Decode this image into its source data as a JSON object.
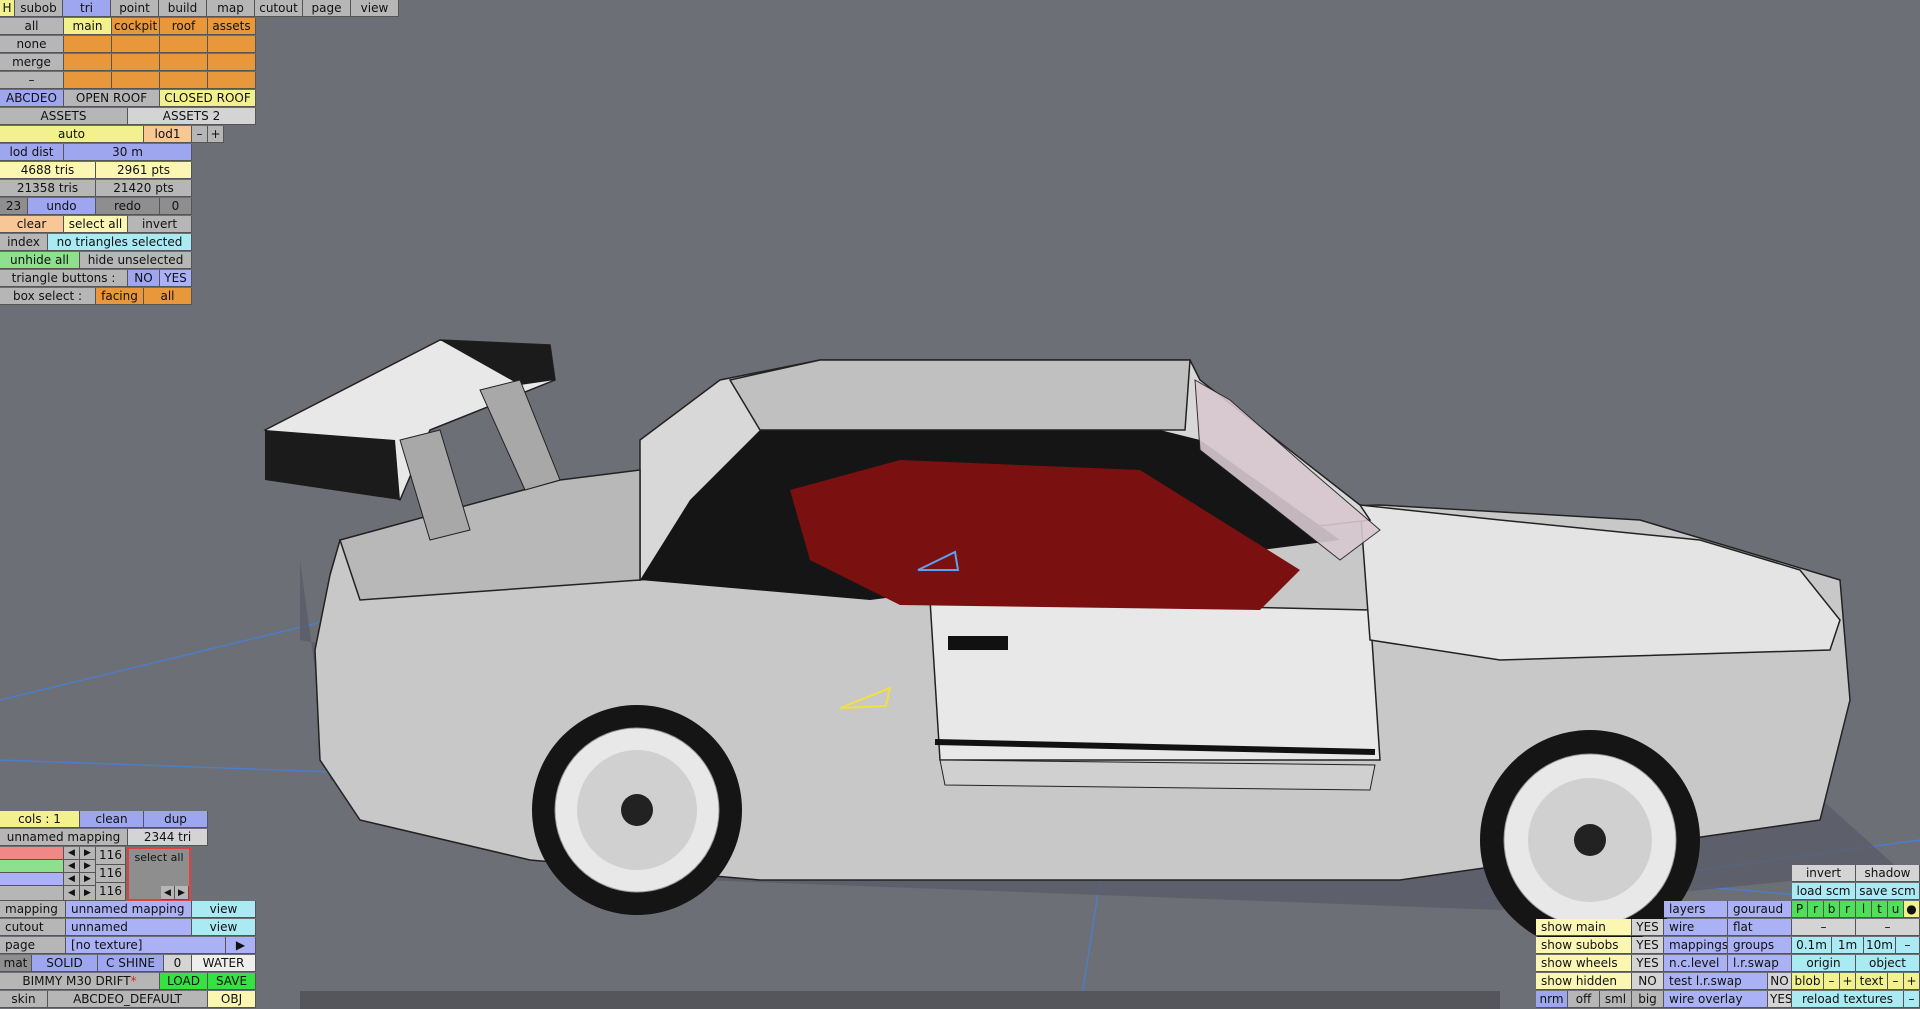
{
  "menu": {
    "h": "H",
    "items": [
      "subob",
      "tri",
      "point",
      "build",
      "map",
      "cutout",
      "page",
      "view"
    ]
  },
  "subob": {
    "all": "all",
    "none": "none",
    "merge": "merge",
    "minus": "–",
    "names": [
      "main",
      "cockpit",
      "roof",
      "assets"
    ]
  },
  "configs": [
    "ABCDEO",
    "OPEN ROOF",
    "CLOSED ROOF"
  ],
  "assets": [
    "ASSETS",
    "ASSETS 2"
  ],
  "lod": {
    "mode": "auto",
    "level": "lod1",
    "minus": "–",
    "plus": "+",
    "dist_label": "lod dist",
    "dist_value": "30 m"
  },
  "stats": {
    "lod_tris": "4688 tris",
    "lod_pts": "2961 pts",
    "total_tris": "21358 tris",
    "total_pts": "21420 pts"
  },
  "history": {
    "undo_count": "23",
    "undo": "undo",
    "redo": "redo",
    "redo_count": "0"
  },
  "selection": {
    "clear": "clear",
    "select_all": "select all",
    "invert": "invert",
    "index_label": "index",
    "status": "no triangles selected"
  },
  "visibility": {
    "unhide_all": "unhide all",
    "hide_unselected": "hide unselected"
  },
  "triangle_buttons": {
    "label": "triangle buttons :",
    "no": "NO",
    "yes": "YES"
  },
  "box_select": {
    "label": "box select :",
    "facing": "facing",
    "all": "all"
  },
  "cols": {
    "label": "cols : 1",
    "clean": "clean",
    "dup": "dup"
  },
  "mapping_panel": {
    "name": "unnamed mapping",
    "tris": "2344 tri"
  },
  "colors": [
    "116",
    "116",
    "116"
  ],
  "arrows": {
    "left": "◀",
    "right": "▶"
  },
  "colour_preview": {
    "label": "select all"
  },
  "bottom_panel": {
    "mapping_label": "mapping",
    "mapping_value": "unnamed mapping",
    "view": "view",
    "cutout_label": "cutout",
    "cutout_value": "unnamed",
    "page_label": "page",
    "page_value": "[no texture]",
    "page_arrow": "▶"
  },
  "material": {
    "label": "mat",
    "solid": "SOLID",
    "c_shine": "C SHINE",
    "value": "0",
    "water": "WATER"
  },
  "model": {
    "name": "BIMMY M30 DRIFT",
    "modified": "*",
    "load": "LOAD",
    "save": "SAVE"
  },
  "skin": {
    "label": "skin",
    "value": "ABCDEO_DEFAULT",
    "obj": "OBJ"
  },
  "view_panel": {
    "invert": "invert",
    "shadow": "shadow",
    "load_scm": "load scm",
    "save_scm": "save scm"
  },
  "show": [
    {
      "label": "show main",
      "value": "YES"
    },
    {
      "label": "show subobs",
      "value": "YES"
    },
    {
      "label": "show wheels",
      "value": "YES"
    },
    {
      "label": "show hidden",
      "value": "NO"
    }
  ],
  "normals": [
    "nrm",
    "off",
    "sml",
    "big"
  ],
  "render": {
    "layers": "layers",
    "gouraud": "gouraud",
    "wire": "wire",
    "flat": "flat",
    "mappings": "mappings",
    "groups": "groups",
    "nc_level": "n.c.level",
    "lr_swap": "l.r.swap",
    "test_lr_swap": "test l.r.swap",
    "test_lr_swap_value": "NO",
    "wire_overlay": "wire overlay",
    "wire_overlay_value": "YES"
  },
  "filters": [
    "P",
    "r",
    "b",
    "r",
    "l",
    "t",
    "u",
    "●"
  ],
  "grid": {
    "dash": "–",
    "sizes": [
      "0.1m",
      "1m",
      "10m"
    ],
    "origin": "origin",
    "object": "object"
  },
  "blob": {
    "label": "blob",
    "minus": "–",
    "plus": "+"
  },
  "text_size": {
    "label": "text",
    "minus": "–",
    "plus": "+"
  },
  "reload_textures": "reload textures",
  "theme": {
    "background": "#6c6f75",
    "accent_blue": "#9ea6ef",
    "accent_orange": "#e8973b",
    "accent_green": "#35e23f"
  }
}
